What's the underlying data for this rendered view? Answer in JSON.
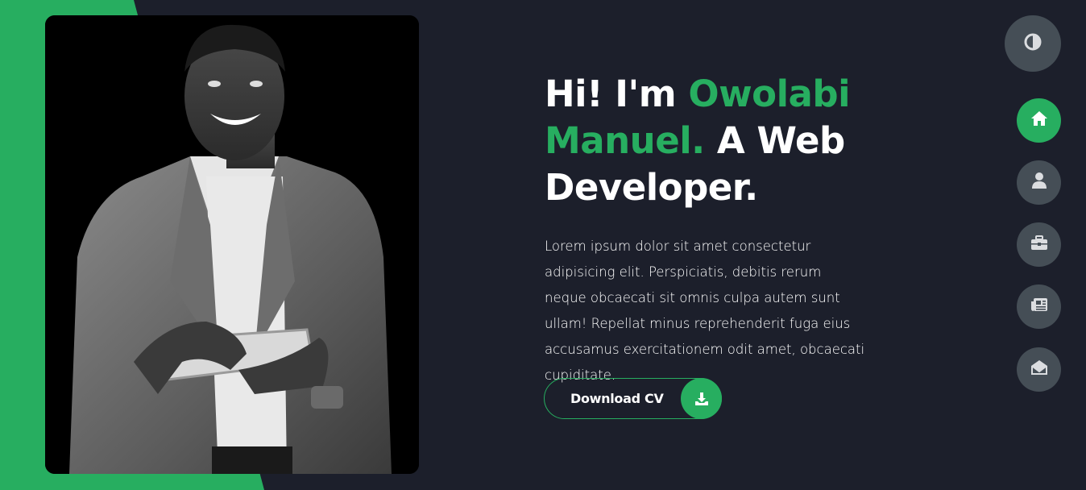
{
  "hero": {
    "title_hi": "Hi! I'm ",
    "title_name": "Owolabi Manuel.",
    "title_rest": " A Web Developer.",
    "description": "Lorem ipsum dolor sit amet consectetur adipisicing elit. Perspiciatis, debitis rerum neque obcaecati sit omnis culpa autem sunt ullam! Repellat minus reprehenderit fuga eius accusamus exercitationem odit amet, obcaecati cupiditate."
  },
  "cv_button": {
    "label": "Download CV",
    "icon": "download-icon"
  },
  "controls": {
    "theme_toggle_icon": "contrast-icon"
  },
  "nav": [
    {
      "icon": "home-icon",
      "active": true
    },
    {
      "icon": "user-icon",
      "active": false
    },
    {
      "icon": "briefcase-icon",
      "active": false
    },
    {
      "icon": "newspaper-icon",
      "active": false
    },
    {
      "icon": "envelope-open-icon",
      "active": false
    }
  ],
  "colors": {
    "accent": "#27ae60",
    "background": "#1c1f2b",
    "button_gray": "#454e56",
    "icon_gray": "#dbdde0"
  }
}
